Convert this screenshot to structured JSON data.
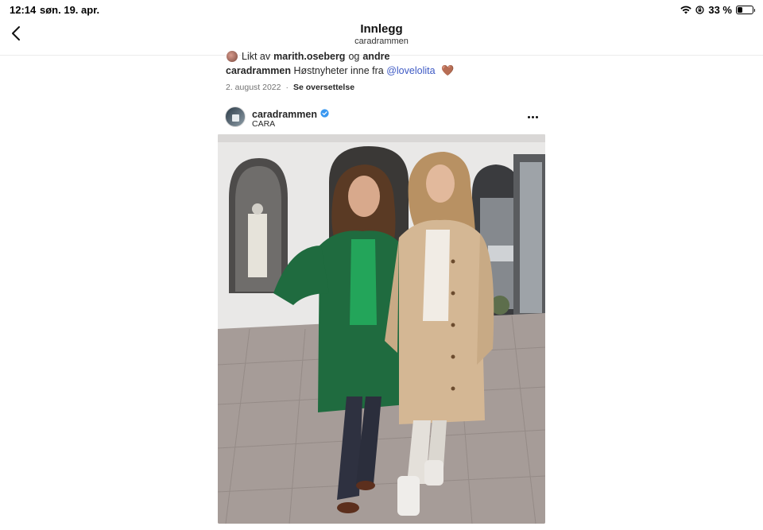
{
  "status_bar": {
    "time": "12:14",
    "date": "søn. 19. apr.",
    "battery_text": "33 %",
    "battery_level": 0.33,
    "icons": [
      "wifi-icon",
      "rotation-lock-icon",
      "battery-icon"
    ]
  },
  "nav": {
    "title": "Innlegg",
    "subtitle": "caradrammen",
    "back_icon": "chevron-left-icon"
  },
  "previous_post": {
    "liked_prefix": "Likt av",
    "liked_user": "marith.oseberg",
    "liked_joiner": "og",
    "liked_others": "andre",
    "caption_user": "caradrammen",
    "caption_text": "Høstnyheter inne fra",
    "caption_mention": "@lovelolita",
    "caption_emoji": "🤎",
    "date": "2. august 2022",
    "separator": "·",
    "translate_label": "Se oversettelse"
  },
  "post": {
    "username": "caradrammen",
    "verified": true,
    "location": "CARA",
    "more_icon": "more-horizontal-icon",
    "image_icon": "photo-two-women-coats"
  },
  "colors": {
    "accent_link": "#3d59c4",
    "verified_blue": "#3897f0",
    "text": "#262626",
    "muted": "#737373"
  }
}
